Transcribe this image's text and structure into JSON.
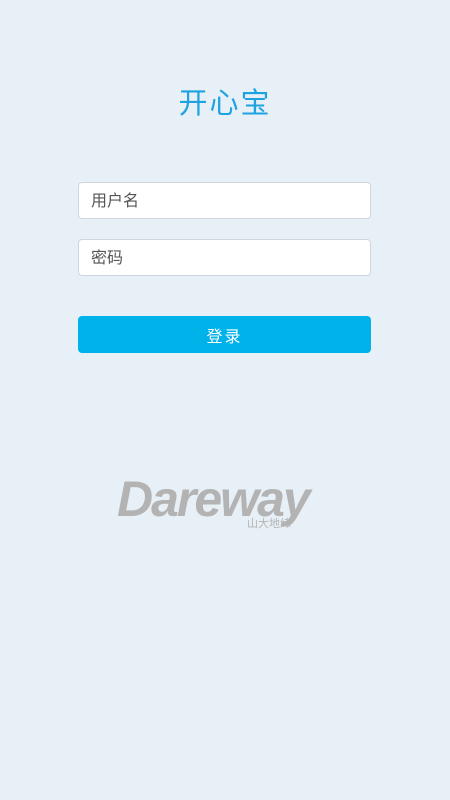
{
  "app": {
    "title": "开心宝"
  },
  "form": {
    "username_placeholder": "用户名",
    "password_placeholder": "密码",
    "login_label": "登录"
  },
  "logo": {
    "brand_text": "Dareway",
    "sub_text": "山大地纬"
  },
  "colors": {
    "title": "#1ea3e0",
    "button": "#00b2ea",
    "background": "#e8f0f7",
    "logo": "#b3b3b3"
  }
}
